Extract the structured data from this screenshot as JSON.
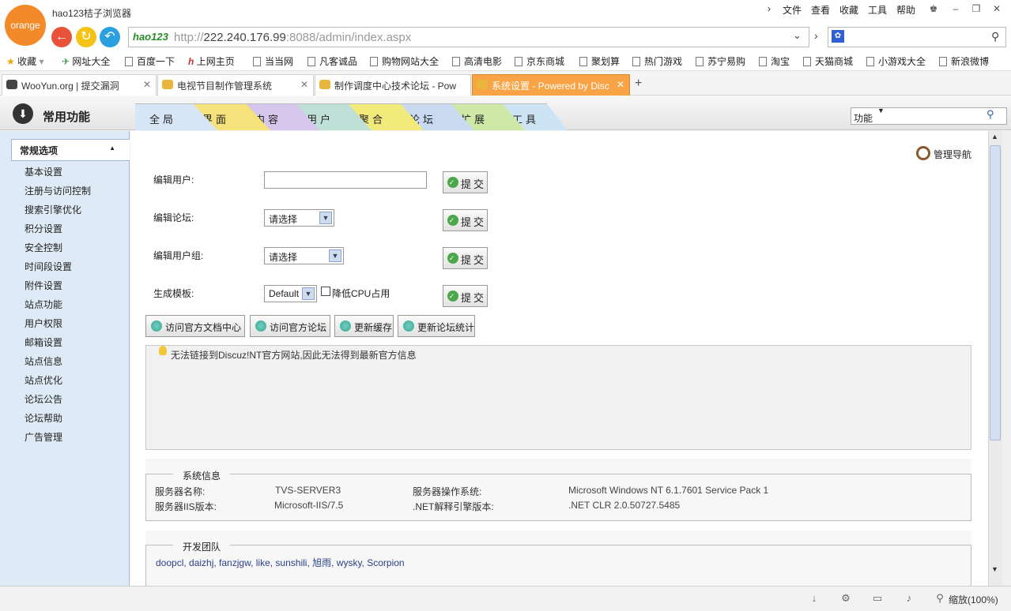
{
  "browser": {
    "logo_text": "orange",
    "title": "hao123桔子浏览器",
    "menu": [
      "文件",
      "查看",
      "收藏",
      "工具",
      "帮助"
    ],
    "address": {
      "logo": "hao123",
      "scheme": "http://",
      "host": "222.240.176.99",
      "rest": ":8088/admin/index.aspx"
    },
    "favorites": [
      "收藏",
      "网址大全",
      "百度一下",
      "上网主页",
      "当当网",
      "凡客诚品",
      "购物网站大全",
      "高清电影",
      "京东商城",
      "聚划算",
      "热门游戏",
      "苏宁易购",
      "淘宝",
      "天猫商城",
      "小游戏大全",
      "新浪微博"
    ],
    "tabs": [
      {
        "label": "WooYun.org | 提交漏洞",
        "active": false
      },
      {
        "label": "电视节目制作管理系统",
        "active": false
      },
      {
        "label": "制作调度中心技术论坛 - Pow",
        "active": false
      },
      {
        "label": "系统设置 - Powered by Disc",
        "active": true
      }
    ]
  },
  "admin": {
    "common_title": "常用功能",
    "tabs": [
      {
        "label": "全局",
        "color": "#d7e6f6"
      },
      {
        "label": "界面",
        "color": "#f6e27a"
      },
      {
        "label": "内容",
        "color": "#d6c6ec"
      },
      {
        "label": "用户",
        "color": "#bfe0d6"
      },
      {
        "label": "聚合",
        "color": "#f3ea7c"
      },
      {
        "label": "论坛",
        "color": "#c9d9f0"
      },
      {
        "label": "扩展",
        "color": "#cfe8a8"
      },
      {
        "label": "工具",
        "color": "#cde4f5"
      }
    ],
    "search_value": "功能",
    "nav_guide": "管理导航"
  },
  "sidebar": {
    "header": "常规选项",
    "items": [
      "基本设置",
      "注册与访问控制",
      "搜索引擎优化",
      "积分设置",
      "安全控制",
      "时间段设置",
      "附件设置",
      "站点功能",
      "用户权限",
      "邮箱设置",
      "站点信息",
      "站点优化",
      "论坛公告",
      "论坛帮助",
      "广告管理"
    ]
  },
  "form": {
    "edit_user_label": "编辑用户:",
    "edit_forum_label": "编辑论坛:",
    "edit_group_label": "编辑用户组:",
    "gen_template_label": "生成模板:",
    "forum_select": "请选择",
    "group_select": "请选择",
    "template_select": "Default",
    "cpu_checkbox": "降低CPU占用",
    "submit": "提交"
  },
  "actions": [
    "访问官方文档中心",
    "访问官方论坛",
    "更新缓存",
    "更新论坛统计"
  ],
  "info_message": "无法链接到Discuz!NT官方网站,因此无法得到最新官方信息",
  "system_info": {
    "title": "系统信息",
    "server_name_label": "服务器名称:",
    "server_name": "TVS-SERVER3",
    "server_os_label": "服务器操作系统:",
    "server_os": "Microsoft Windows NT 6.1.7601 Service Pack 1",
    "iis_label": "服务器IIS版本:",
    "iis": "Microsoft-IIS/7.5",
    "net_label": ".NET解释引擎版本:",
    "net": ".NET CLR 2.0.50727.5485"
  },
  "team": {
    "title": "开发团队",
    "members": "doopcl, daizhj, fanzjgw, like, sunshili, 旭雨, wysky, Scorpion"
  },
  "status": {
    "zoom": "缩放(100%)"
  }
}
